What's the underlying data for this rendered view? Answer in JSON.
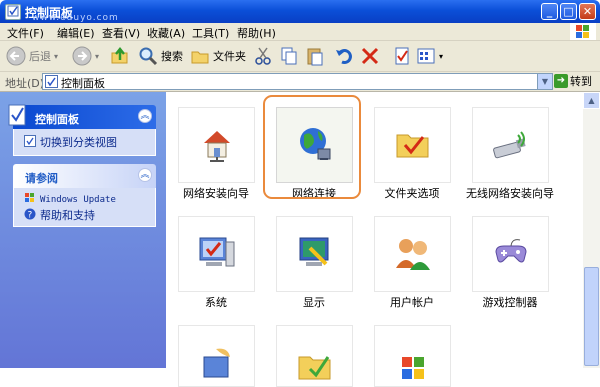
{
  "window": {
    "title": "控制面板",
    "watermark": "www.eduyo.com"
  },
  "menu": {
    "items": [
      "文件(F)",
      "编辑(E)",
      "查看(V)",
      "收藏(A)",
      "工具(T)",
      "帮助(H)"
    ]
  },
  "toolbar": {
    "back_label": "后退",
    "search_label": "搜索",
    "folders_label": "文件夹"
  },
  "address": {
    "label": "地址(D)",
    "value": "控制面板",
    "go_label": "转到"
  },
  "sidebar": {
    "panel1": {
      "title": "控制面板",
      "link": "切换到分类视图"
    },
    "panel2": {
      "title": "请参阅",
      "links": [
        "Windows Update",
        "帮助和支持"
      ]
    }
  },
  "items": [
    "网络安装向导",
    "网络连接",
    "文件夹选项",
    "无线网络安装向导",
    "系统",
    "显示",
    "用户帐户",
    "游戏控制器"
  ]
}
